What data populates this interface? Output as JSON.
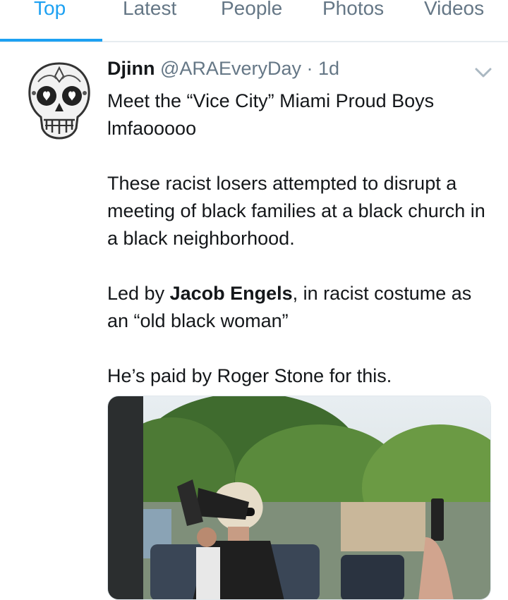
{
  "tabs": [
    {
      "label": "Top",
      "active": true
    },
    {
      "label": "Latest",
      "active": false
    },
    {
      "label": "People",
      "active": false
    },
    {
      "label": "Photos",
      "active": false
    },
    {
      "label": "Videos",
      "active": false
    }
  ],
  "colors": {
    "accent": "#1da1f2",
    "secondary_text": "#657786",
    "primary_text": "#14171a"
  },
  "tweet": {
    "avatar_icon": "sugar-skull-icon",
    "display_name": "Djinn",
    "handle": "@ARAEveryDay",
    "separator": "·",
    "time": "1d",
    "menu_icon": "chevron-down-icon",
    "line1": "Meet the “Vice City” Miami Proud Boys",
    "line2": "lmfaooooo",
    "para2": "These racist losers attempted to disrupt a meeting of black families at a black church in a black neighborhood.",
    "para3_prefix": "Led by ",
    "para3_bold": "Jacob Engels",
    "para3_suffix": ", in racist costume as an “old black woman”",
    "para4": "He’s paid by Roger Stone for this.",
    "media_type": "photo of a woman speaking into a megaphone outdoors"
  }
}
